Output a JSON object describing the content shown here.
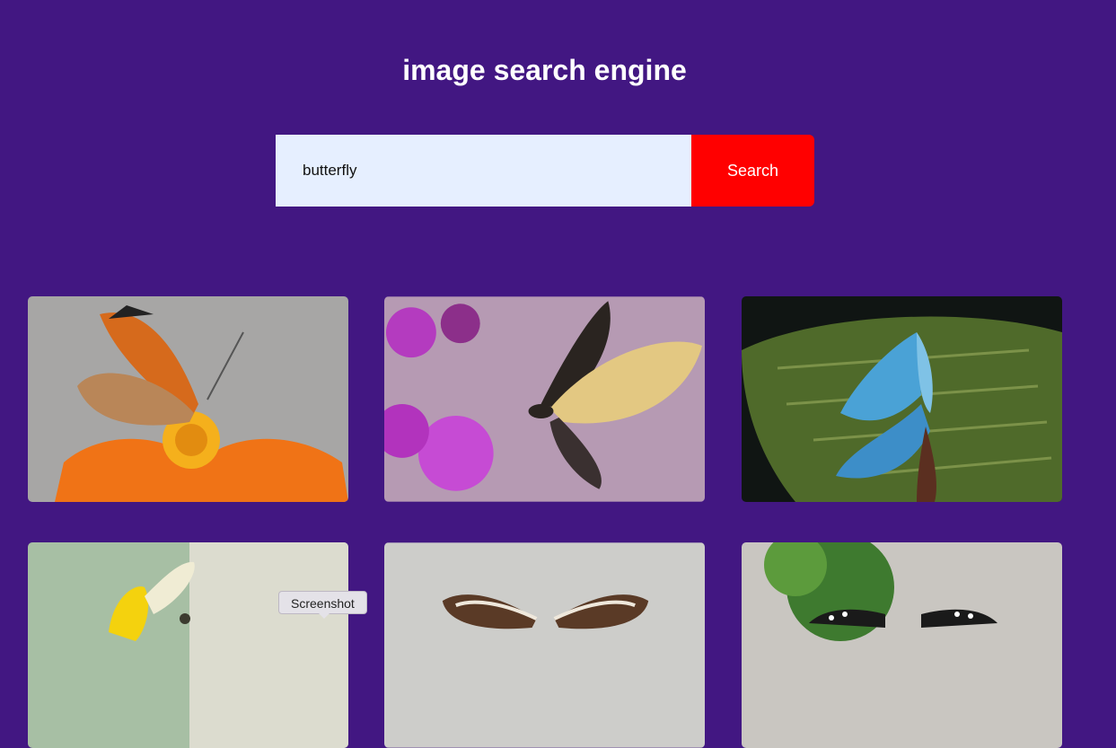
{
  "header": {
    "title": "image search engine"
  },
  "search": {
    "value": "butterfly",
    "button_label": "Search"
  },
  "colors": {
    "background": "#421782",
    "button": "#ff0000",
    "input_bg": "#e6efff"
  },
  "results": [
    {
      "subject": "painted lady butterfly on orange flower"
    },
    {
      "subject": "swallowtail butterfly on purple thistle"
    },
    {
      "subject": "blue morpho butterfly on green leaf"
    },
    {
      "subject": "butterfly on yellow flower"
    },
    {
      "subject": "brown and white butterfly"
    },
    {
      "subject": "black and white butterfly on plant"
    }
  ],
  "tooltip": {
    "label": "Screenshot"
  }
}
